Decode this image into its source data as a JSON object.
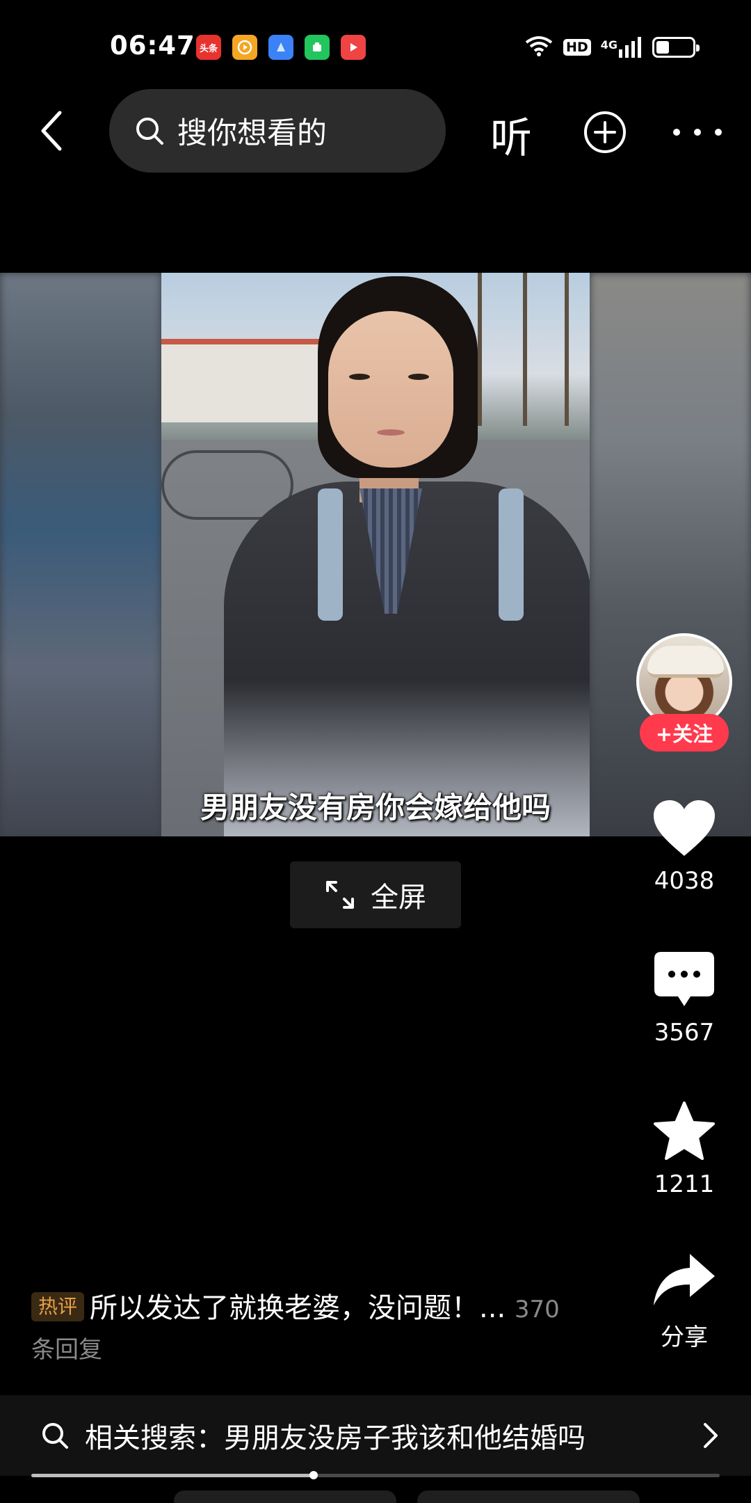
{
  "status_bar": {
    "time": "06:47",
    "apps": [
      {
        "name": "toutiao-app-icon",
        "label": "头条",
        "color": "#e8322e"
      },
      {
        "name": "video-app-icon",
        "label": "",
        "color": "#f5a623"
      },
      {
        "name": "blue-app-icon",
        "label": "",
        "color": "#3b82f6"
      },
      {
        "name": "green-app-icon",
        "label": "",
        "color": "#22c55e"
      },
      {
        "name": "play-app-icon",
        "label": "",
        "color": "#ef4444"
      }
    ],
    "hd_label": "HD",
    "network_label": "4G",
    "battery_level": 0.35
  },
  "top_bar": {
    "search_placeholder": "搜你想看的",
    "listen_label": "听"
  },
  "video": {
    "subtitle": "男朋友没有房你会嫁给他吗"
  },
  "fullscreen": {
    "label": "全屏"
  },
  "actions": {
    "follow_label": "+关注",
    "like_count": "4038",
    "comment_count": "3567",
    "favorite_count": "1211",
    "share_label": "分享"
  },
  "hot_comment": {
    "badge": "热评",
    "text": "所以发达了就换老婆，没问题！",
    "ellipsis": "...",
    "reply_count": "370",
    "reply_suffix": "条回复"
  },
  "related_search": {
    "text": "相关搜索：男朋友没房子我该和他结婚吗"
  },
  "progress": {
    "fraction": 0.41
  },
  "colors": {
    "background": "#000000",
    "follow_red": "#ff3a4d",
    "hot_badge_text": "#e8a046"
  }
}
